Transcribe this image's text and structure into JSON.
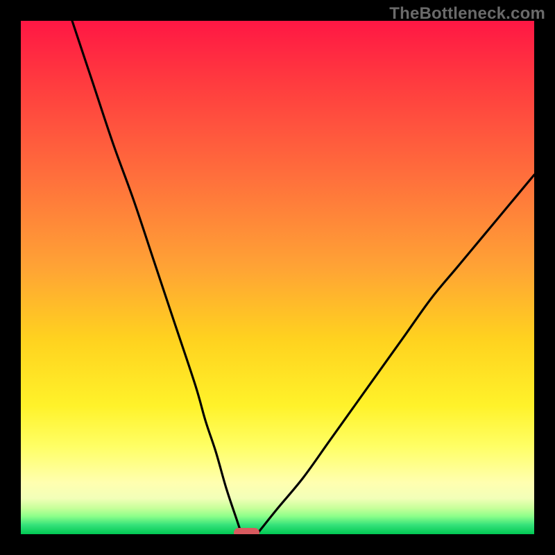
{
  "watermark": "TheBottleneck.com",
  "chart_data": {
    "type": "line",
    "title": "",
    "xlabel": "",
    "ylabel": "",
    "xlim": [
      0,
      100
    ],
    "ylim": [
      0,
      100
    ],
    "grid": false,
    "legend": false,
    "series": [
      {
        "name": "left-curve",
        "x": [
          10,
          14,
          18,
          22,
          26,
          30,
          34,
          36,
          38,
          40,
          42,
          43
        ],
        "y": [
          100,
          88,
          76,
          65,
          53,
          41,
          29,
          22,
          16,
          9,
          3,
          0
        ]
      },
      {
        "name": "right-curve",
        "x": [
          46,
          50,
          55,
          60,
          65,
          70,
          75,
          80,
          85,
          90,
          95,
          100
        ],
        "y": [
          0,
          5,
          11,
          18,
          25,
          32,
          39,
          46,
          52,
          58,
          64,
          70
        ]
      }
    ],
    "marker": {
      "name": "bottleneck-marker",
      "x_center": 44,
      "width_pct": 5,
      "color": "#d85a5f"
    },
    "gradient": {
      "stops": [
        {
          "pct": 0,
          "color": "#ff1744"
        },
        {
          "pct": 12,
          "color": "#ff3b3f"
        },
        {
          "pct": 30,
          "color": "#ff6e3c"
        },
        {
          "pct": 48,
          "color": "#ffa335"
        },
        {
          "pct": 62,
          "color": "#ffd21f"
        },
        {
          "pct": 75,
          "color": "#fff22a"
        },
        {
          "pct": 83,
          "color": "#ffff66"
        },
        {
          "pct": 90,
          "color": "#ffffb0"
        },
        {
          "pct": 93,
          "color": "#f2ffb8"
        },
        {
          "pct": 95,
          "color": "#c5ff99"
        },
        {
          "pct": 96.5,
          "color": "#8dff8a"
        },
        {
          "pct": 98.2,
          "color": "#35e27a"
        },
        {
          "pct": 100,
          "color": "#00c853"
        }
      ]
    }
  }
}
